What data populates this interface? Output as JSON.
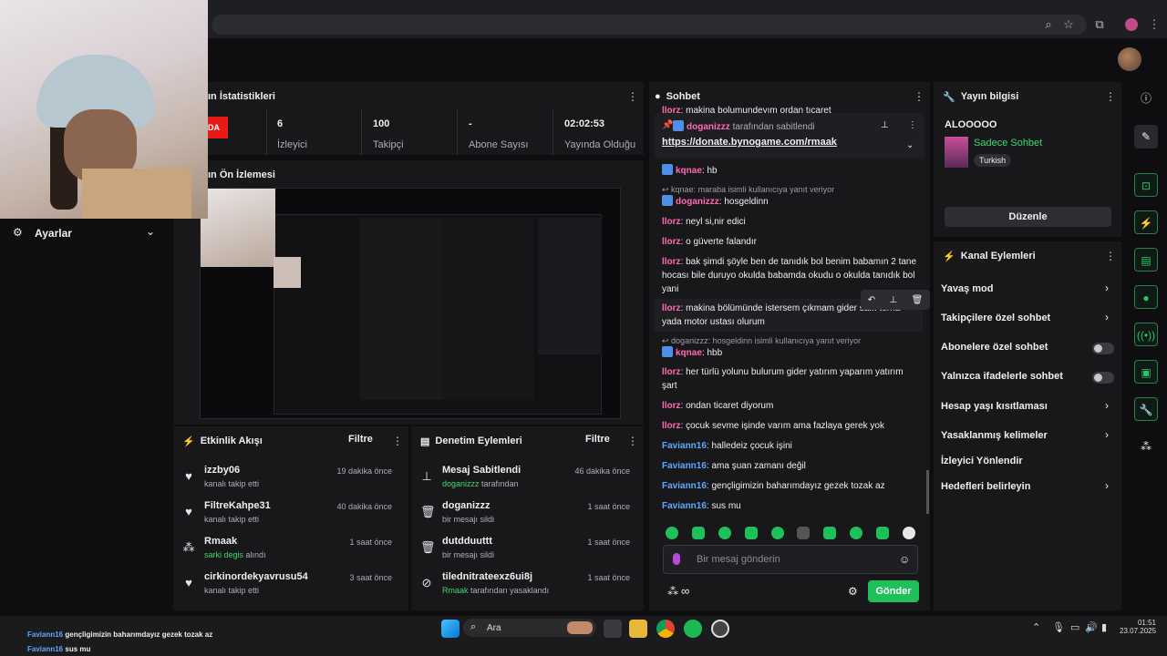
{
  "stats_panel": {
    "title": "ın İstatistikleri",
    "live_tag": "DA",
    "stats": [
      {
        "value": "6",
        "label": "İzleyici"
      },
      {
        "value": "100",
        "label": "Takipçi"
      },
      {
        "value": "-",
        "label": "Abone Sayısı"
      },
      {
        "value": "02:02:53",
        "label": "Yayında Olduğu"
      }
    ]
  },
  "preview_panel": {
    "title": "ın Ön İzlemesi"
  },
  "settings_panel": {
    "label": "Ayarlar"
  },
  "activity_feed": {
    "title": "Etkinlik Akışı",
    "filter_label": "Filtre",
    "items": [
      {
        "name": "izzby06",
        "detail": "kanalı takip etti",
        "time": "19 dakika önce",
        "icon": "heart-icon"
      },
      {
        "name": "FiltreKahpe31",
        "detail": "kanalı takip etti",
        "time": "40 dakika önce",
        "icon": "heart-icon"
      },
      {
        "name": "Rmaak",
        "detail_highlight": "sarki degis",
        "detail": "alındı",
        "time": "1 saat önce",
        "icon": "reward-icon"
      },
      {
        "name": "cirkinordekyavrusu54",
        "detail": "kanalı takip etti",
        "time": "3 saat önce",
        "icon": "heart-icon"
      }
    ]
  },
  "moderation": {
    "title": "Denetim Eylemleri",
    "filter_label": "Filtre",
    "items": [
      {
        "name": "Mesaj Sabitlendi",
        "detail_highlight": "doganizzz",
        "detail": "tarafından",
        "time": "46 dakika önce",
        "icon": "pin-icon"
      },
      {
        "name": "doganizzz",
        "detail": "bir mesajı sildi",
        "time": "1 saat önce",
        "icon": "trash-icon"
      },
      {
        "name": "dutdduuttt",
        "detail": "bir mesajı sildi",
        "time": "1 saat önce",
        "icon": "trash-icon"
      },
      {
        "name": "tilednitrateexz6ui8j",
        "detail_highlight": "Rmaak",
        "detail": "tarafından yasaklandı",
        "time": "1 saat önce",
        "icon": "ban-icon"
      }
    ]
  },
  "chat": {
    "title": "Sohbet",
    "top_partial": "makina bolumundeyım ordan tıcaret",
    "top_partial_user": "llorz",
    "pinned": {
      "user": "doganizzz",
      "suffix": "tarafından sabitlendi",
      "link": "https://donate.bynogame.com/rmaak"
    },
    "messages": [
      {
        "type": "msg",
        "user": "kqnae",
        "text": "hb",
        "color": "pink",
        "badge": true
      },
      {
        "type": "reply",
        "text": "kqnae: maraba isimli kullanıcıya yanıt veriyor"
      },
      {
        "type": "msg",
        "user": "doganizzz",
        "text": "hosgeldinn",
        "color": "pink",
        "badge": true
      },
      {
        "type": "msg",
        "user": "llorz",
        "text": "neyl si,nir edici",
        "color": "pink"
      },
      {
        "type": "msg",
        "user": "llorz",
        "text": "o güverte falandır",
        "color": "pink"
      },
      {
        "type": "msg",
        "user": "llorz",
        "text": "bak şimdi şöyle ben de tanıdık bol benim babamın 2 tane hocası bile duruyo okulda babamda okudu o okulda tanıdık bol yani",
        "color": "pink"
      },
      {
        "type": "msg",
        "user": "llorz",
        "text": "makina bölümünde istersem çıkmam gider sa... torna yada motor ustası olurum",
        "color": "pink"
      },
      {
        "type": "reply",
        "text": "doganizzz: hosgeldinn isimli kullanıcıya yanıt veriyor"
      },
      {
        "type": "msg",
        "user": "kqnae",
        "text": "hbb",
        "color": "pink",
        "badge": true
      },
      {
        "type": "msg",
        "user": "llorz",
        "text": "her türlü yolunu bulurum gider yatırım yaparım yatırım şart",
        "color": "pink"
      },
      {
        "type": "msg",
        "user": "llorz",
        "text": "ondan ticaret diyorum",
        "color": "pink"
      },
      {
        "type": "msg",
        "user": "llorz",
        "text": "çocuk sevme işinde varım ama fazlaya gerek yok",
        "color": "pink"
      },
      {
        "type": "msg",
        "user": "Faviann16",
        "text": "halledeiz çocuk işini",
        "color": "blue"
      },
      {
        "type": "msg",
        "user": "Faviann16",
        "text": "ama şuan zamanı değil",
        "color": "blue"
      },
      {
        "type": "msg",
        "user": "Faviann16",
        "text": "gençligimizin baharımdayız gezek tozak az",
        "color": "blue"
      },
      {
        "type": "msg",
        "user": "Faviann16",
        "text": "sus mu",
        "color": "blue"
      }
    ],
    "input_placeholder": "Bir mesaj gönderin",
    "send_label": "Gönder",
    "infinity": "∞"
  },
  "stream_info": {
    "title": "Yayın bilgisi",
    "stream_title": "ALOOOOO",
    "category": "Sadece Sohbet",
    "language": "Turkish",
    "edit_label": "Düzenle"
  },
  "channel_actions": {
    "title": "Kanal Eylemleri",
    "items": [
      {
        "label": "Yavaş mod",
        "control": "chevron"
      },
      {
        "label": "Takipçilere özel sohbet",
        "control": "chevron"
      },
      {
        "label": "Abonelere özel sohbet",
        "control": "toggle"
      },
      {
        "label": "Yalnızca ifadelerle sohbet",
        "control": "toggle"
      },
      {
        "label": "Hesap yaşı kısıtlaması",
        "control": "chevron"
      },
      {
        "label": "Yasaklanmış kelimeler",
        "control": "chevron"
      },
      {
        "label": "İzleyici Yönlendir",
        "control": "none"
      },
      {
        "label": "Hedefleri belirleyin",
        "control": "chevron"
      }
    ]
  },
  "overlay_chat": [
    {
      "user": "Faviann16",
      "text": "gençligimizin baharımdayız gezek tozak az"
    },
    {
      "user": "Faviann16",
      "text": "sus mu"
    }
  ],
  "taskbar": {
    "search_label": "Ara",
    "time": "01:51",
    "date": "23.07.2025"
  }
}
